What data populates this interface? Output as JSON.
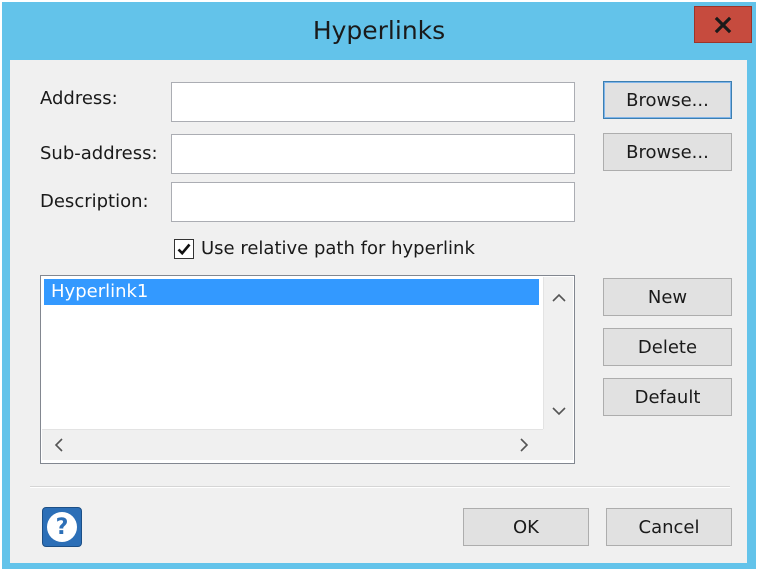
{
  "window": {
    "title": "Hyperlinks",
    "close_glyph": "✕",
    "titlebar_color": "#63c3ea",
    "close_color": "#c64b3e"
  },
  "form": {
    "address_label": "Address:",
    "address_value": "",
    "subaddress_label": "Sub-address:",
    "subaddress_value": "",
    "description_label": "Description:",
    "description_value": "",
    "browse_label": "Browse...",
    "relative_path_label": "Use relative path for hyperlink",
    "relative_path_checked": true
  },
  "hyperlinks": {
    "items": [
      "Hyperlink1"
    ],
    "selected_index": 0,
    "selection_color": "#3399ff"
  },
  "actions": {
    "new_label": "New",
    "delete_label": "Delete",
    "default_label": "Default"
  },
  "footer": {
    "help_glyph": "?",
    "ok_label": "OK",
    "cancel_label": "Cancel"
  },
  "icons": [
    "close-icon",
    "checkmark-icon",
    "chevron-up-icon",
    "chevron-down-icon",
    "chevron-left-icon",
    "chevron-right-icon",
    "help-icon"
  ]
}
